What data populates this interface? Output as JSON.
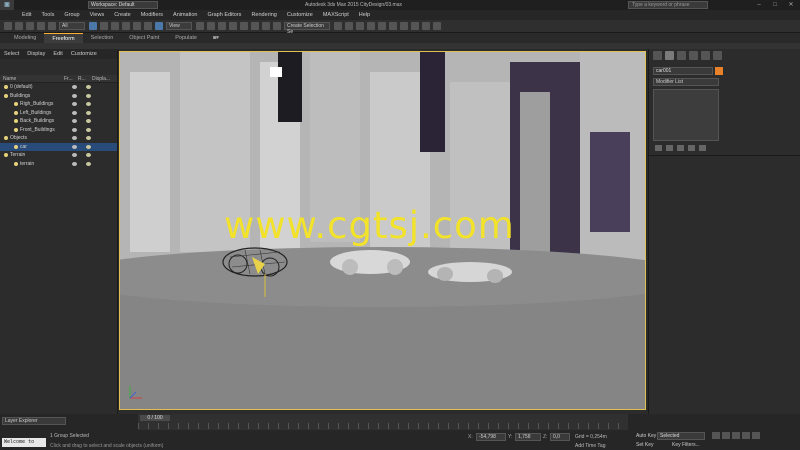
{
  "titlebar": {
    "workspace": "Workspace: Default",
    "title": "Autodesk 3ds Max 2015       CityDesign/03.max",
    "search_placeholder": "Type a keyword or phrase"
  },
  "menubar": {
    "items": [
      "Edit",
      "Tools",
      "Group",
      "Views",
      "Create",
      "Modifiers",
      "Animation",
      "Graph Editors",
      "Rendering",
      "Customize",
      "MAXScript",
      "Help"
    ]
  },
  "toolbar": {
    "filter": "All",
    "view": "View",
    "selection_set": "Create Selection Se"
  },
  "ribbon": {
    "tabs": [
      "Modeling",
      "Freeform",
      "Selection",
      "Object Paint",
      "Populate"
    ],
    "active_tab": "Freeform"
  },
  "scene_explorer": {
    "menu": [
      "Select",
      "Display",
      "Edit",
      "Customize"
    ],
    "columns": [
      "Name",
      "Fr...",
      "R...",
      "Displa..."
    ],
    "rows": [
      {
        "label": "0 (default)",
        "indent": 1,
        "selected": false
      },
      {
        "label": "Buildings",
        "indent": 1,
        "selected": false
      },
      {
        "label": "Righ_Buildings",
        "indent": 2,
        "selected": false
      },
      {
        "label": "Left_Buildings",
        "indent": 2,
        "selected": false
      },
      {
        "label": "Back_Buildings",
        "indent": 2,
        "selected": false
      },
      {
        "label": "Front_Buildings",
        "indent": 2,
        "selected": false
      },
      {
        "label": "Objects",
        "indent": 1,
        "selected": false
      },
      {
        "label": "car",
        "indent": 2,
        "selected": true
      },
      {
        "label": "Terrain",
        "indent": 1,
        "selected": false
      },
      {
        "label": "terrain",
        "indent": 2,
        "selected": false
      }
    ]
  },
  "viewport": {
    "watermark": "www.cgtsj.com"
  },
  "command_panel": {
    "object_name": "car001",
    "object_color": "#e8822a",
    "modifier_list": "Modifier List"
  },
  "bottom": {
    "layer_explorer": "Layer Explorer",
    "time_slider": "0 / 100",
    "maxscript": "Welcome to MAX",
    "status": "1 Group Selected",
    "prompt": "Click and drag to select and scale objects (uniform)",
    "x_value": "-54,798",
    "y_value": "1,758",
    "z_value": "0,0",
    "grid": "Grid = 0,254m",
    "time_tag": "Add Time Tag",
    "auto_key": "Auto Key",
    "set_key": "Set Key",
    "selected_dropdown": "Selected",
    "key_filters": "Key Filters..."
  }
}
